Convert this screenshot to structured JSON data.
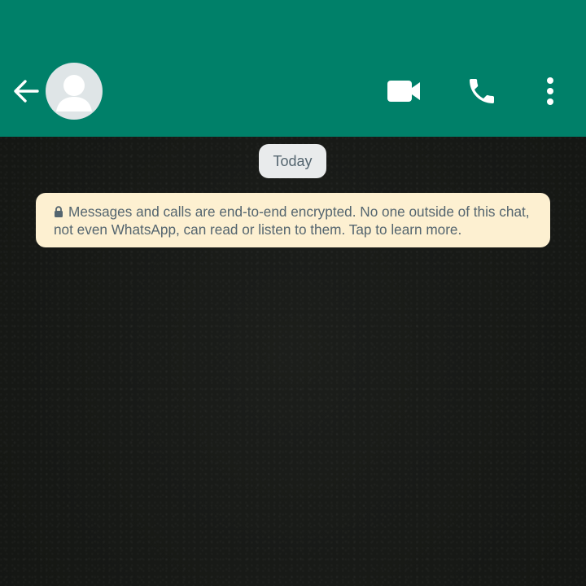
{
  "header": {
    "background_color": "#008069",
    "back_icon": "arrow-left-icon",
    "avatar_icon": "default-person-icon",
    "actions": [
      {
        "icon": "video-camera-icon"
      },
      {
        "icon": "phone-icon"
      },
      {
        "icon": "more-vertical-icon"
      }
    ]
  },
  "chat": {
    "date_chip": "Today",
    "encryption_notice": "Messages and calls are end-to-end encrypted. No one outside of this chat, not even WhatsApp, can read or listen to them. Tap to learn more.",
    "notice_icon": "lock-icon",
    "notice_background": "#fdf0d1",
    "wallpaper_color": "#161815"
  }
}
